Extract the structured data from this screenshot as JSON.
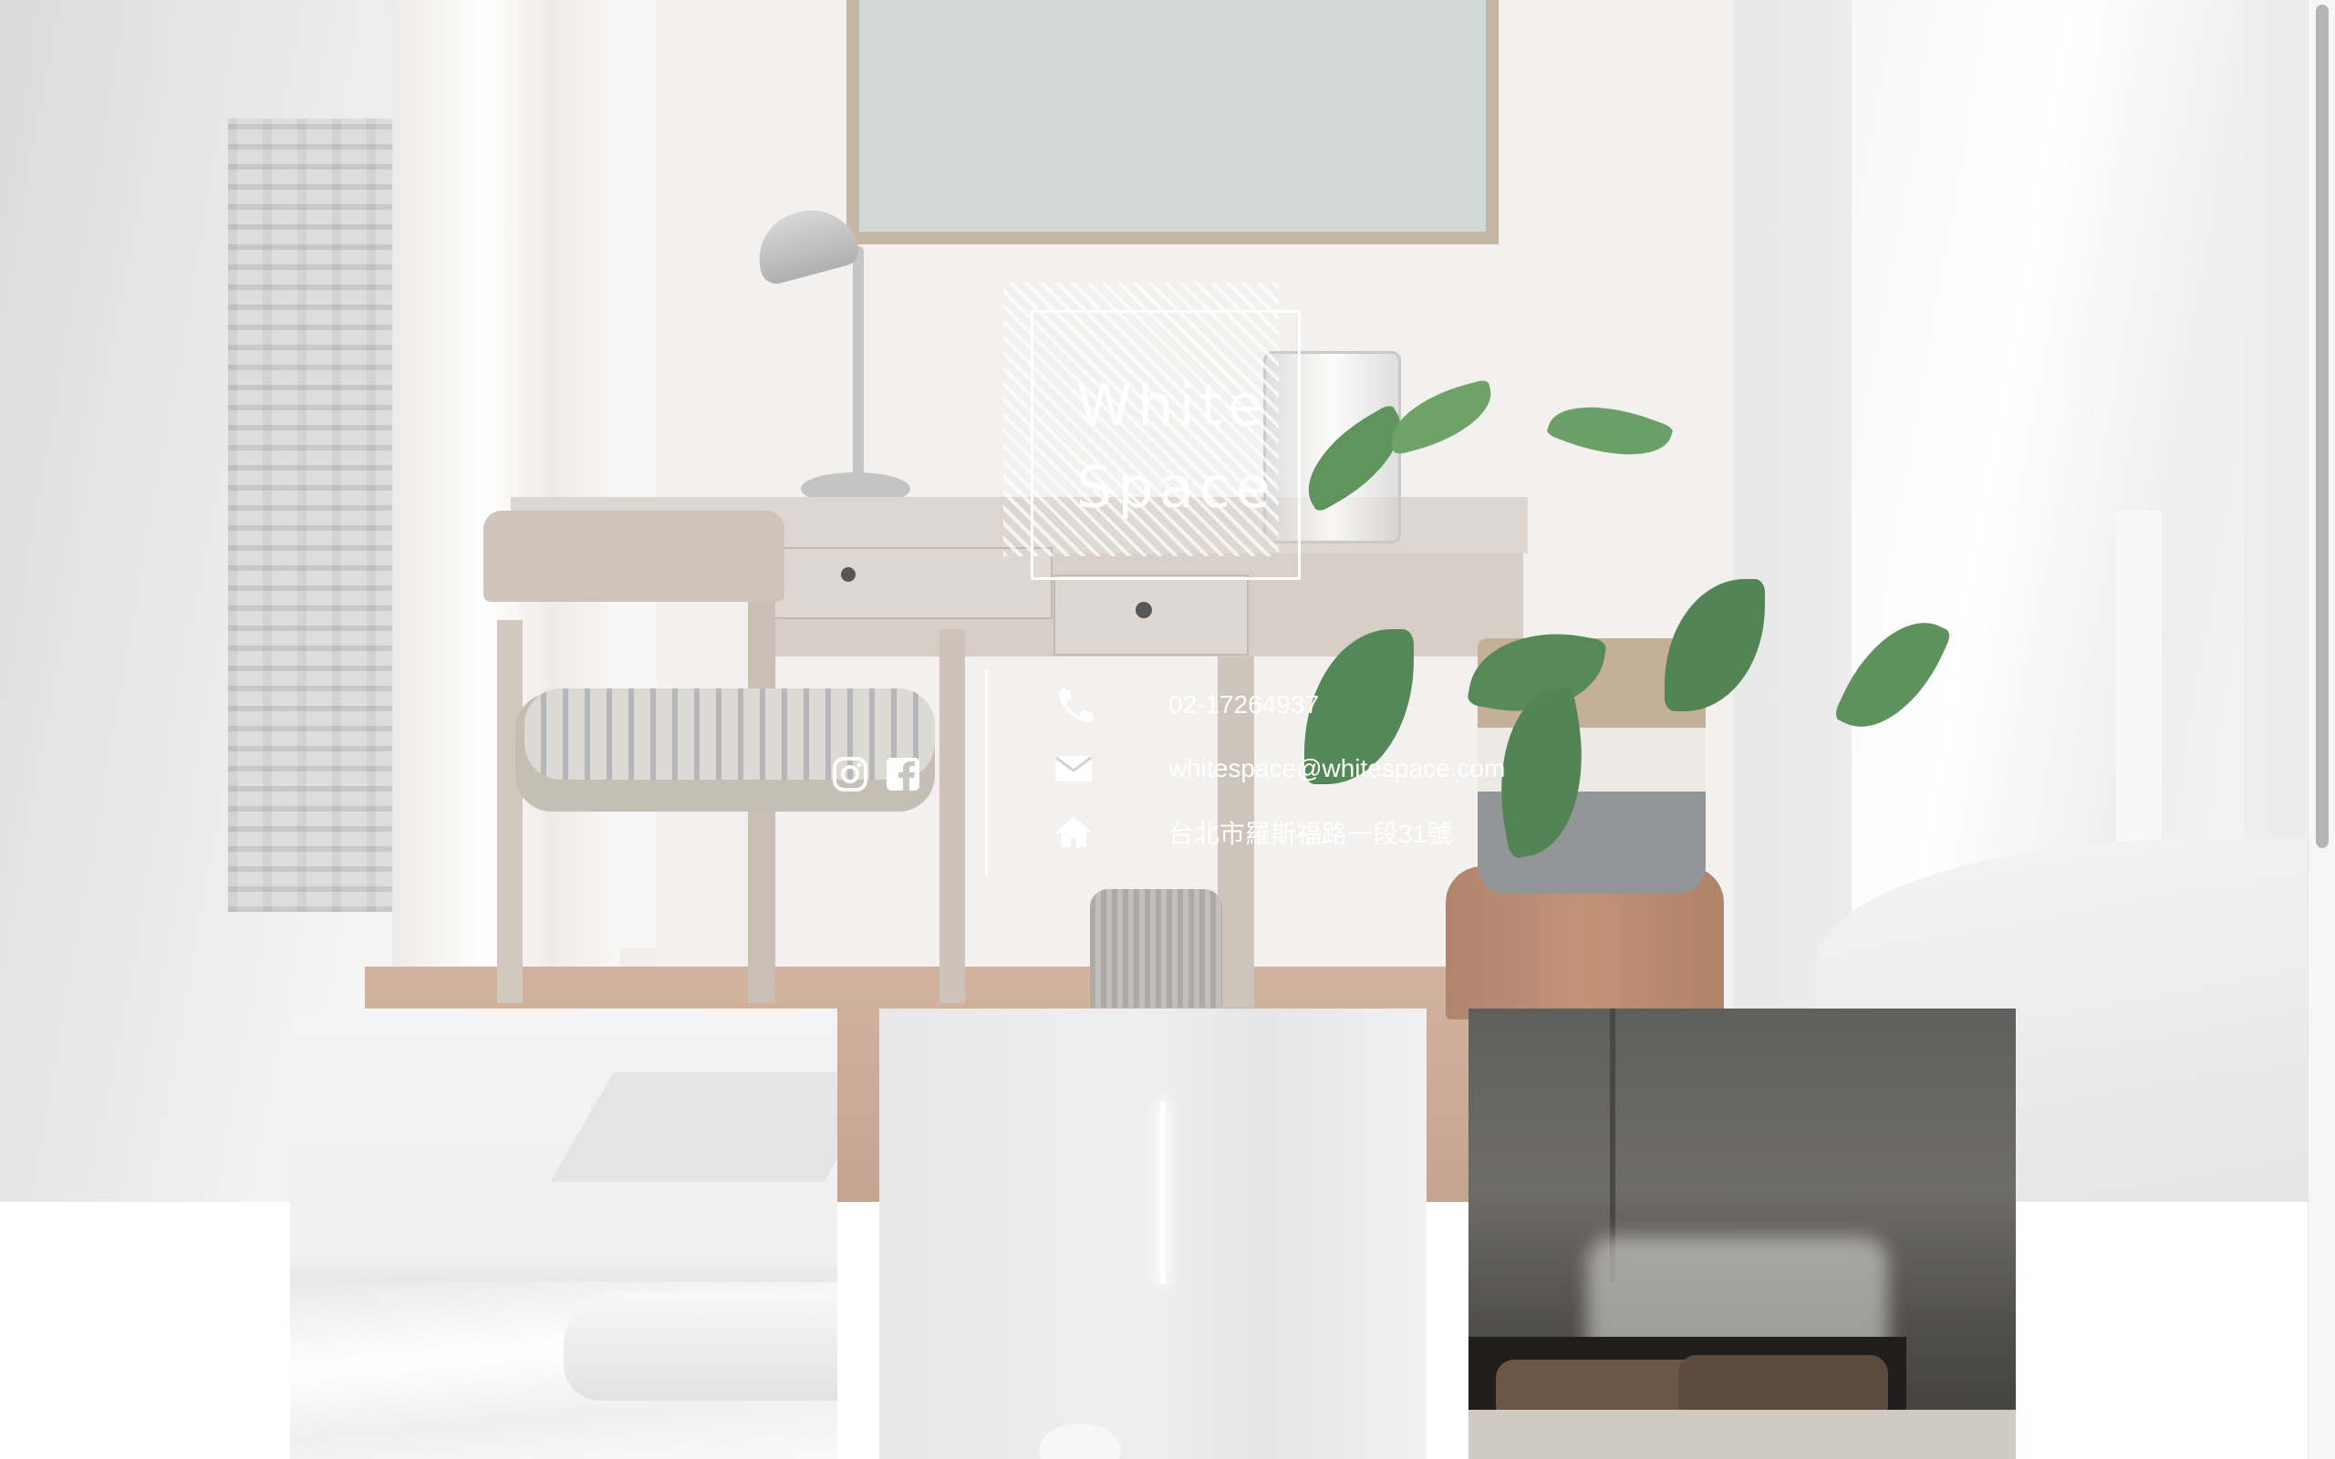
{
  "brand": {
    "line1": "White",
    "line2": "Space"
  },
  "social": [
    {
      "icon": "instagram-icon"
    },
    {
      "icon": "facebook-icon"
    }
  ],
  "contact": {
    "phone": "02-17264937",
    "email": "whitespace@whitespace.com",
    "address": "台北市羅斯福路一段31號"
  },
  "colors": {
    "text": "#ffffff",
    "accent_white": "#ffffff",
    "page_background": "#ffffff"
  },
  "gallery": [
    {
      "image": "white-bed-room-photo"
    },
    {
      "image": "white-wall-light-photo"
    },
    {
      "image": "concrete-bedroom-photo"
    }
  ]
}
